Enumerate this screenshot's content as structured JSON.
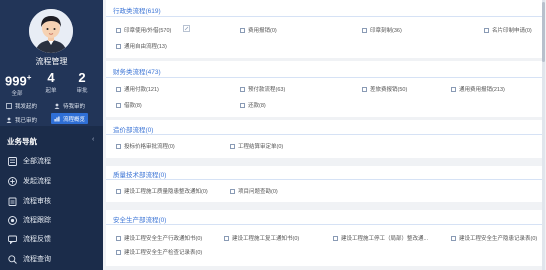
{
  "profile": {
    "username": "流程管理",
    "stats": [
      {
        "value": "999",
        "sup": "+",
        "label": "全部"
      },
      {
        "value": "4",
        "sup": "",
        "label": "起单"
      },
      {
        "value": "2",
        "sup": "",
        "label": "审批"
      }
    ]
  },
  "quick_links": {
    "initiated": "我发起的",
    "pending": "待我审的",
    "done": "我已审的",
    "overview": "流程概览"
  },
  "nav": {
    "title": "业务导航",
    "items": [
      "全部流程",
      "发起流程",
      "流程审核",
      "流程跟踪",
      "流程反馈",
      "流程查询"
    ]
  },
  "sections": [
    {
      "title": "行政类流程(619)",
      "items": [
        "印章使用/外借(570)",
        "费用报销(0)",
        "印章刻制(36)",
        "名片印制申请(0)",
        "通用自由流程(13)"
      ]
    },
    {
      "title": "财务类流程(473)",
      "items": [
        "通用付款(121)",
        "预付款流程(63)",
        "差旅费报销(50)",
        "通用费用报销(213)",
        "借款(8)",
        "还款(8)"
      ]
    },
    {
      "title": "造价部流程(0)",
      "items": [
        "投标价格审批流程(0)",
        "工程结算审定单(0)"
      ]
    },
    {
      "title": "质量技术部流程(0)",
      "items": [
        "建设工程施工质量隐患整改通知(0)",
        "项目问题查勘(0)"
      ]
    },
    {
      "title": "安全生产部流程(0)",
      "items": [
        "建设工程安全生产行政通知书(0)",
        "建设工程施工复工通知书(0)",
        "建设工程施工停工（局部）整改通...",
        "建设工程安全生产隐患记录表(0)",
        "建设工程安全生产检查记录表(0)"
      ]
    }
  ]
}
